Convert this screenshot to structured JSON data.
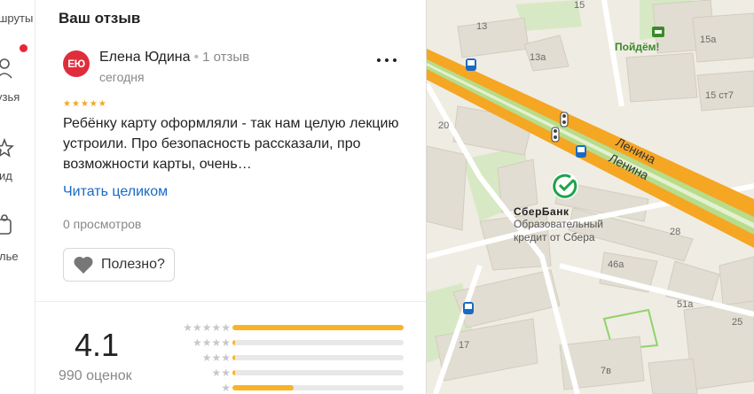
{
  "nav": {
    "items": [
      {
        "label": "шруты"
      },
      {
        "label": "узья"
      },
      {
        "label": "ид"
      },
      {
        "label": "лье"
      }
    ]
  },
  "review": {
    "section_title": "Ваш отзыв",
    "avatar_initials": "ЕЮ",
    "author_name": "Елена Юдина",
    "author_review_count": "1 отзыв",
    "date": "сегодня",
    "stars": 5,
    "text": "Ребёнку карту оформляли - так нам целую лекцию устроили. Про безопасность рассказали, про возможности карты, очень…",
    "read_more": "Читать целиком",
    "views": "0 просмотров",
    "useful_label": "Полезно?"
  },
  "rating": {
    "value": "4.1",
    "count_label": "990 оценок",
    "distribution": [
      {
        "stars": 5,
        "fraction": 1.0
      },
      {
        "stars": 4,
        "fraction": 0.015
      },
      {
        "stars": 3,
        "fraction": 0.015
      },
      {
        "stars": 2,
        "fraction": 0.015
      },
      {
        "stars": 1,
        "fraction": 0.36
      }
    ]
  },
  "map": {
    "street_name": "Ленина",
    "poi_name": "СберБанк",
    "poi_desc": "Образовательный кредит от Сбера",
    "poidem": "Пойдём!",
    "house_numbers": [
      "13",
      "13а",
      "15а",
      "15 ст7",
      "15",
      "20",
      "28",
      "46а",
      "51а",
      "25",
      "17",
      "7в"
    ],
    "colors": {
      "road": "#f5a623",
      "road_center": "#b8dc8a",
      "bg": "#efece3",
      "building": "#e2ddd2",
      "park": "#d7e9c4"
    }
  }
}
